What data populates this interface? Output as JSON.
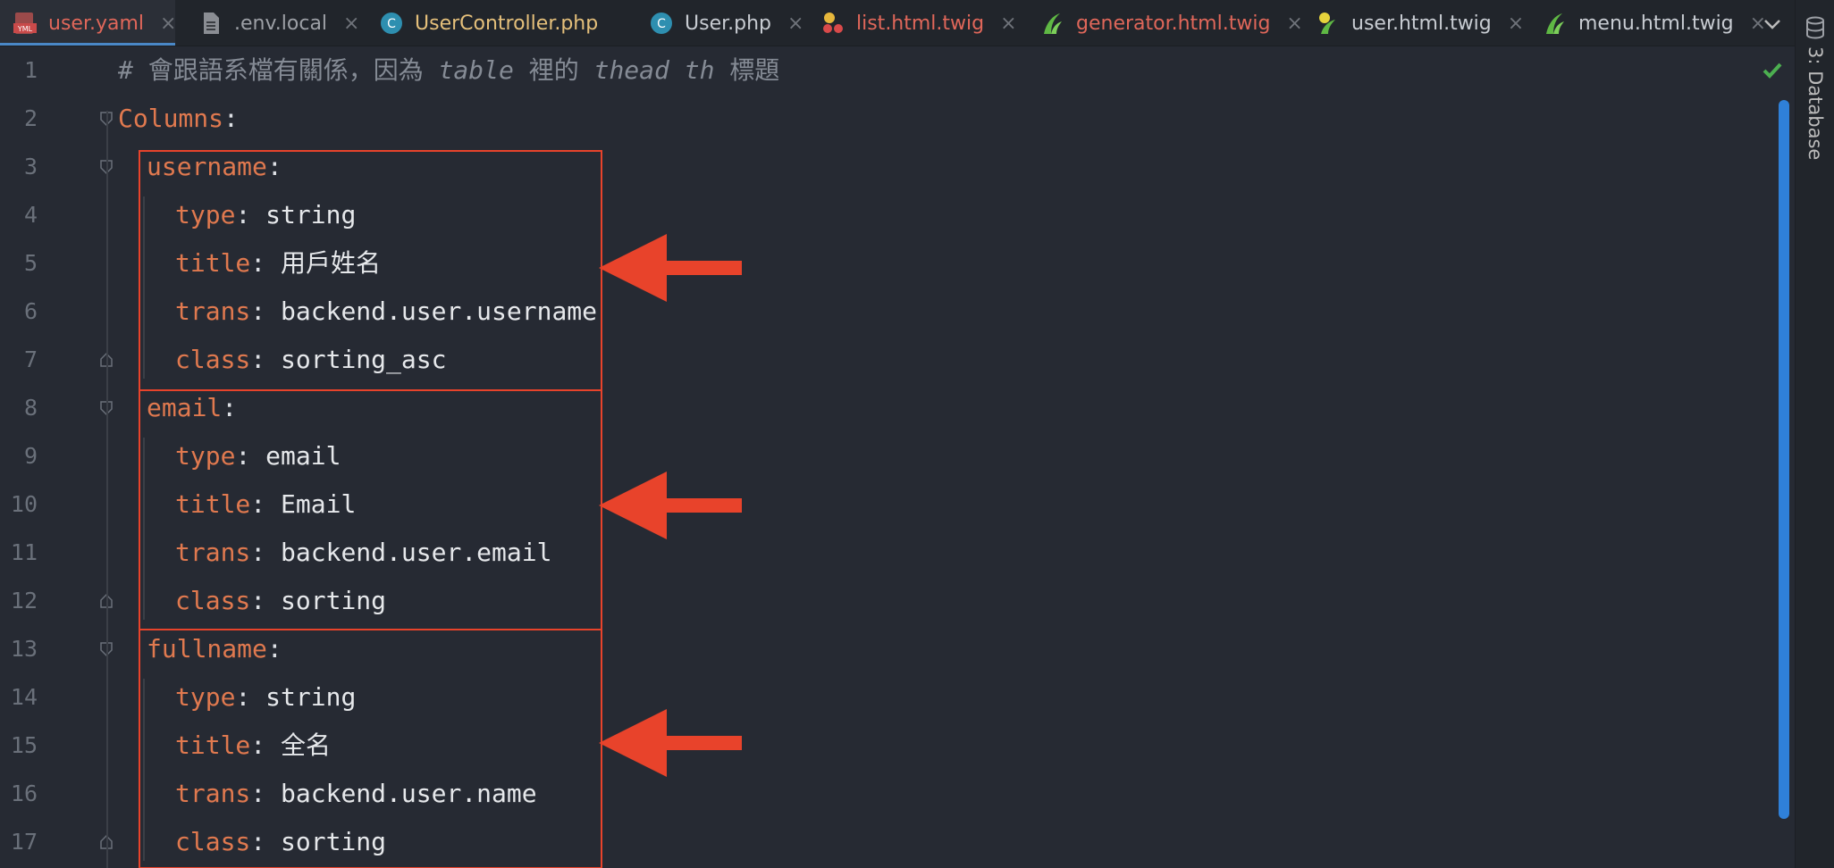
{
  "tabs": [
    {
      "label": "user.yaml",
      "icon": "yaml-file-icon",
      "active": true
    },
    {
      "label": ".env.local",
      "icon": "text-file-icon"
    },
    {
      "label": "UserController.php",
      "icon": "php-class-icon"
    },
    {
      "label": "User.php",
      "icon": "php-class-icon"
    },
    {
      "label": "list.html.twig",
      "icon": "twig-file-icon"
    },
    {
      "label": "generator.html.twig",
      "icon": "twig-file-icon"
    },
    {
      "label": "user.html.twig",
      "icon": "twig-file-icon"
    },
    {
      "label": "menu.html.twig",
      "icon": "twig-file-icon"
    }
  ],
  "close_glyph": "×",
  "toolstrip": {
    "database_label": "3: Database"
  },
  "line_numbers": [
    "1",
    "2",
    "3",
    "4",
    "5",
    "6",
    "7",
    "8",
    "9",
    "10",
    "11",
    "12",
    "13",
    "14",
    "15",
    "16",
    "17"
  ],
  "code": {
    "comment": {
      "hash": "# ",
      "part1": "會跟語系檔有關係，因為 ",
      "kw1": "table",
      "part2": " 裡的 ",
      "kw2": "thead th",
      "part3": " 標題"
    },
    "root_key": "Columns",
    "colon": ":",
    "columns": [
      {
        "key": "username",
        "type": "string",
        "title": "用戶姓名",
        "trans": "backend.user.username",
        "class": "sorting_asc"
      },
      {
        "key": "email",
        "type": "email",
        "title": "Email",
        "trans": "backend.user.email",
        "class": "sorting"
      },
      {
        "key": "fullname",
        "type": "string",
        "title": "全名",
        "trans": "backend.user.name",
        "class": "sorting"
      }
    ],
    "field_names": {
      "type": "type",
      "title": "title",
      "trans": "trans",
      "class": "class"
    }
  },
  "colors": {
    "annotation": "#e8432b",
    "accent": "#2f80d8",
    "key": "#e0794f",
    "check": "#4caf50"
  }
}
